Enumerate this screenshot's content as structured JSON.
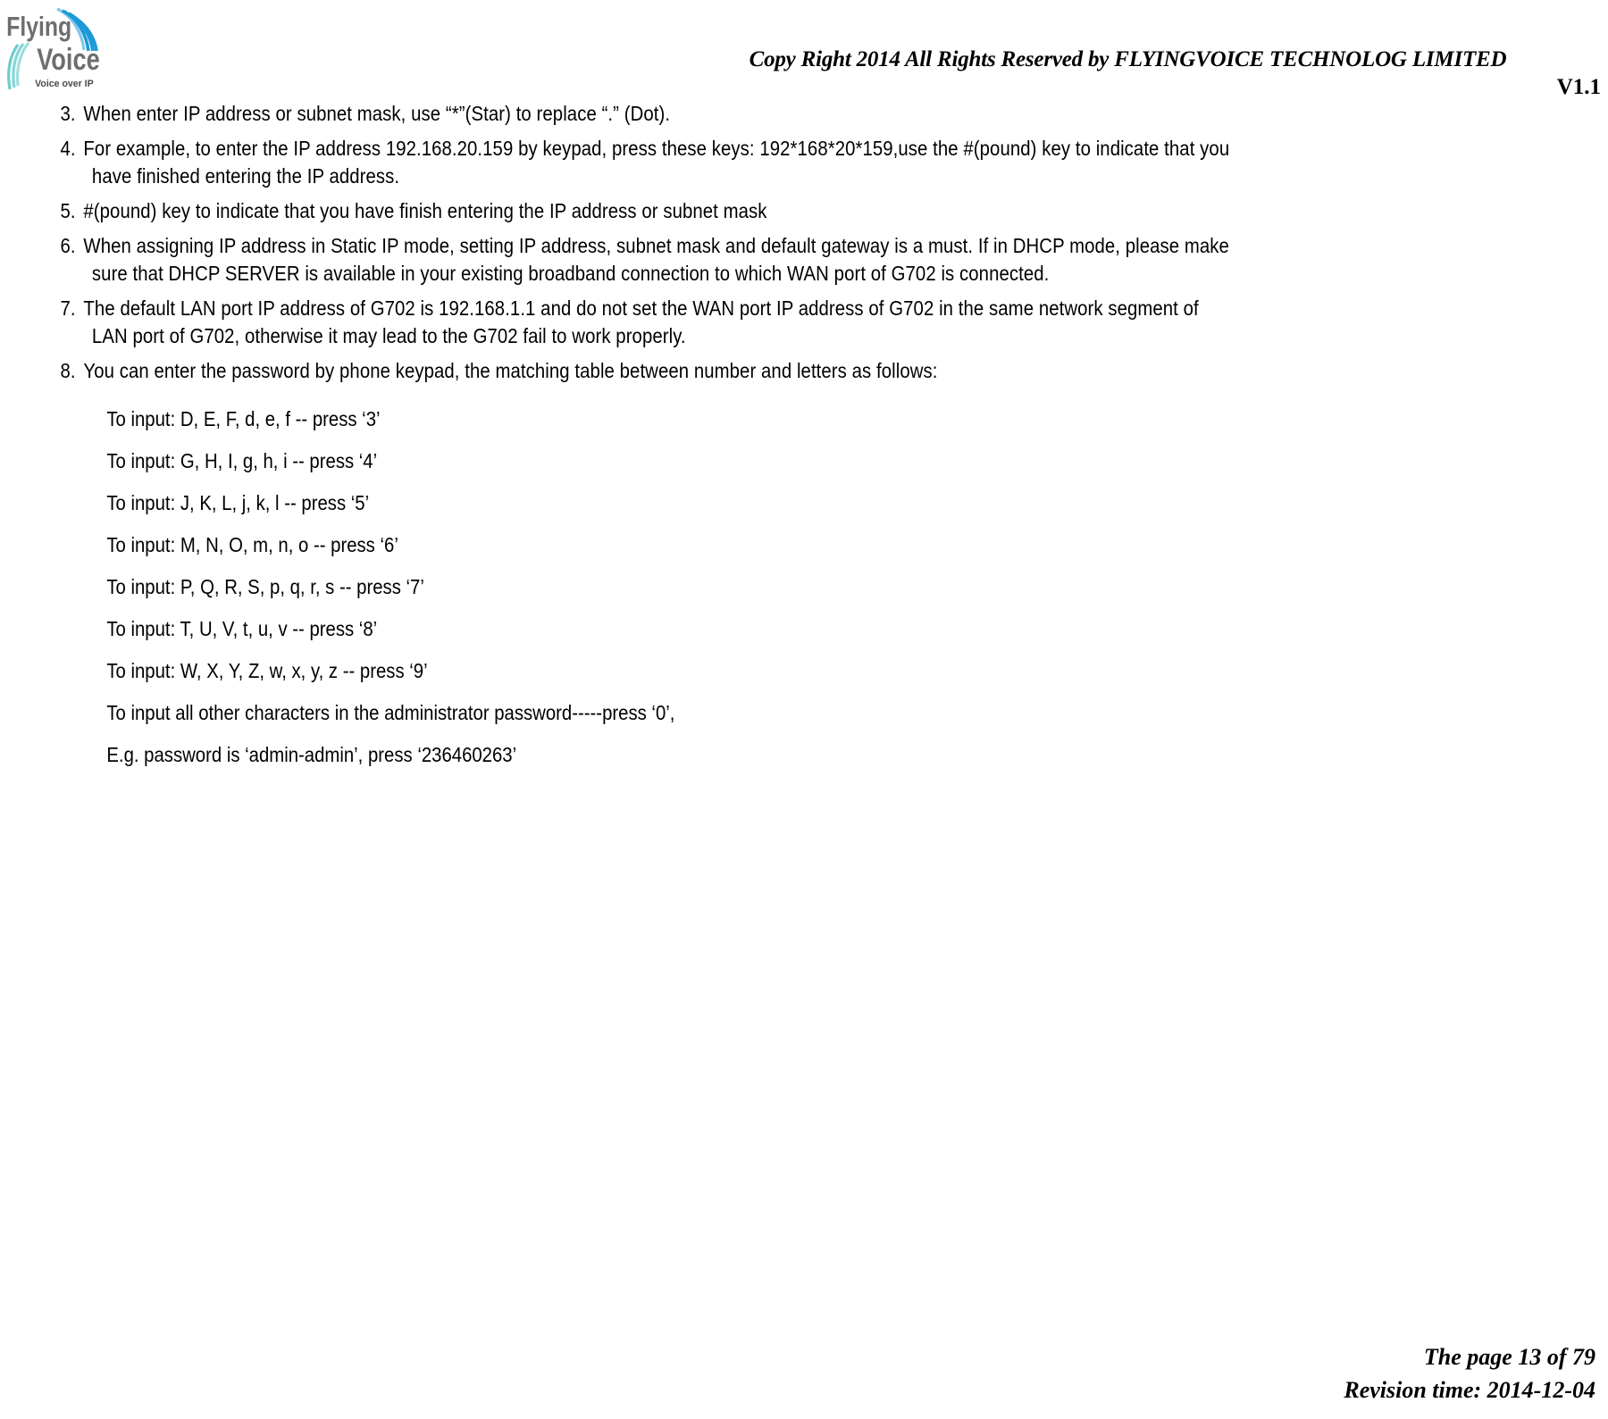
{
  "header": {
    "logo": {
      "word_top": "Flying",
      "word_bottom": "Voice",
      "tagline": "Voice over IP",
      "color_text": "#6e6e6e",
      "color_arc_top": "#1c9ad6",
      "color_arc_bottom": "#5cc8c8"
    },
    "copyright": "Copy Right 2014 All Rights Reserved by FLYINGVOICE TECHNOLOG LIMITED",
    "version": "V1.1"
  },
  "list": [
    {
      "number": "3.",
      "lines": [
        "When enter IP address or subnet mask, use “*”(Star) to replace “.” (Dot)."
      ]
    },
    {
      "number": "4.",
      "lines": [
        "For example, to enter the IP address 192.168.20.159 by keypad, press these keys: 192*168*20*159,use the #(pound) key to indicate that you",
        "have finished entering the IP address."
      ]
    },
    {
      "number": "5.",
      "lines": [
        "#(pound) key to indicate that you have finish entering the IP address or subnet mask"
      ]
    },
    {
      "number": "6.",
      "lines": [
        "When assigning IP address in Static IP mode, setting IP address, subnet mask and default gateway is a must. If in DHCP mode, please make",
        "sure that DHCP SERVER is available in your existing broadband connection to which WAN port of G702 is connected."
      ]
    },
    {
      "number": "7.",
      "lines": [
        "The default LAN port IP address of G702 is 192.168.1.1 and do not set the WAN port IP address of G702 in the same network segment of",
        "LAN port of G702, otherwise it may lead to the G702 fail to work properly."
      ]
    },
    {
      "number": "8.",
      "lines": [
        "You can enter the password by phone keypad, the matching table between number and letters as follows:"
      ]
    }
  ],
  "sub_lines": [
    "To input: D, E, F, d, e, f -- press ‘3’",
    "To input: G, H, I, g, h, i -- press ‘4’",
    "To input: J, K, L, j, k, l -- press ‘5’",
    "To input: M, N, O, m, n, o -- press ‘6’",
    "To input: P, Q, R, S, p, q, r, s -- press ‘7’",
    "To input: T, U, V, t, u, v -- press ‘8’",
    "To input: W, X, Y, Z, w, x, y, z -- press ‘9’",
    "To input all other characters in the administrator password-----press ‘0’,",
    "E.g. password is ‘admin-admin’, press ‘236460263’"
  ],
  "footer": {
    "page": "The page 13 of 79",
    "revision": "Revision time: 2014-12-04"
  }
}
